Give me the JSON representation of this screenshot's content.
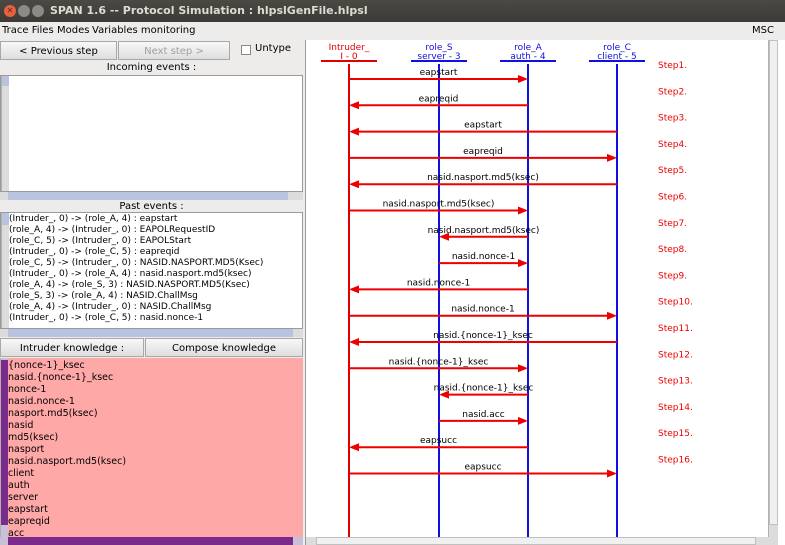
{
  "window": {
    "title": "SPAN 1.6 -- Protocol Simulation : hlpslGenFile.hlpsl"
  },
  "menu": {
    "items": [
      "Trace Files",
      "Modes",
      "Variables monitoring"
    ],
    "right_label": "MSC"
  },
  "controls": {
    "prev_label": "< Previous step",
    "next_label": "Next step >",
    "untype_label": "Untype"
  },
  "incoming": {
    "label": "Incoming events :"
  },
  "past": {
    "label": "Past events :",
    "events": [
      "(Intruder_, 0) -> (role_A, 4) : eapstart",
      "(role_A, 4) -> (Intruder_, 0) : EAPOLRequestID",
      "(role_C, 5) -> (Intruder_, 0) : EAPOLStart",
      "(Intruder_, 0) -> (role_C, 5) : eapreqid",
      "(role_C, 5) -> (Intruder_, 0) : NASID.NASPORT.MD5(Ksec)",
      "(Intruder_, 0) -> (role_A, 4) : nasid.nasport.md5(ksec)",
      "(role_A, 4) -> (role_S, 3) : NASID.NASPORT.MD5(Ksec)",
      "(role_S, 3) -> (role_A, 4) : NASID.ChallMsg",
      "(role_A, 4) -> (Intruder_, 0) : NASID.ChallMsg",
      "(Intruder_, 0) -> (role_C, 5) : nasid.nonce-1"
    ]
  },
  "knowledge": {
    "intruder_label": "Intruder knowledge :",
    "compose_label": "Compose knowledge",
    "items": [
      "{nonce-1}_ksec",
      "nasid.{nonce-1}_ksec",
      "nonce-1",
      "nasid.nonce-1",
      "nasport.md5(ksec)",
      "nasid",
      "md5(ksec)",
      "nasport",
      "nasid.nasport.md5(ksec)",
      "client",
      "auth",
      "server",
      "eapstart",
      "eapreqid",
      "acc"
    ]
  },
  "msc": {
    "roles": [
      {
        "name": "Intruder_",
        "id": "I - 0",
        "color": "#e00000"
      },
      {
        "name": "role_S",
        "id": "server - 3",
        "color": "#1010e0"
      },
      {
        "name": "role_A",
        "id": "auth - 4",
        "color": "#1010e0"
      },
      {
        "name": "role_C",
        "id": "client - 5",
        "color": "#1010e0"
      }
    ],
    "messages": [
      {
        "label": "eapstart",
        "from": 0,
        "to": 2,
        "step": "Step1."
      },
      {
        "label": "eapreqid",
        "from": 2,
        "to": 0,
        "step": "Step2."
      },
      {
        "label": "eapstart",
        "from": 3,
        "to": 0,
        "step": "Step3."
      },
      {
        "label": "eapreqid",
        "from": 0,
        "to": 3,
        "step": "Step4."
      },
      {
        "label": "nasid.nasport.md5(ksec)",
        "from": 3,
        "to": 0,
        "step": "Step5."
      },
      {
        "label": "nasid.nasport.md5(ksec)",
        "from": 0,
        "to": 2,
        "step": "Step6."
      },
      {
        "label": "nasid.nasport.md5(ksec)",
        "from": 2,
        "to": 1,
        "step": "Step7."
      },
      {
        "label": "nasid.nonce-1",
        "from": 1,
        "to": 2,
        "step": "Step8."
      },
      {
        "label": "nasid.nonce-1",
        "from": 2,
        "to": 0,
        "step": "Step9."
      },
      {
        "label": "nasid.nonce-1",
        "from": 0,
        "to": 3,
        "step": "Step10."
      },
      {
        "label": "nasid.{nonce-1}_ksec",
        "from": 3,
        "to": 0,
        "step": "Step11."
      },
      {
        "label": "nasid.{nonce-1}_ksec",
        "from": 0,
        "to": 2,
        "step": "Step12."
      },
      {
        "label": "nasid.{nonce-1}_ksec",
        "from": 2,
        "to": 1,
        "step": "Step13."
      },
      {
        "label": "nasid.acc",
        "from": 1,
        "to": 2,
        "step": "Step14."
      },
      {
        "label": "eapsucc",
        "from": 2,
        "to": 0,
        "step": "Step15."
      },
      {
        "label": "eapsucc",
        "from": 0,
        "to": 3,
        "step": "Step16."
      }
    ],
    "arrow_color": "#ee0000",
    "step_color": "#ee0000"
  }
}
